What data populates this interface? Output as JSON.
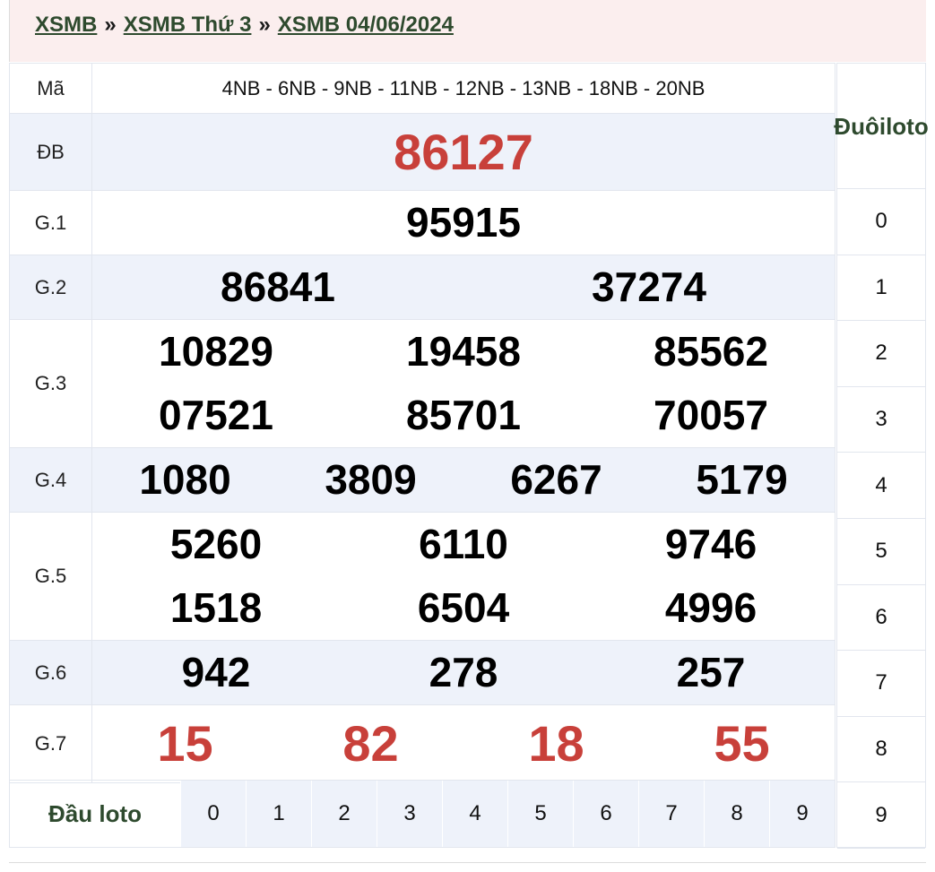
{
  "breadcrumb": {
    "items": [
      "XSMB",
      "XSMB Thứ 3",
      "XSMB 04/06/2024"
    ],
    "separator": "»"
  },
  "results": {
    "code_label": "Mã",
    "codes": "4NB - 6NB - 9NB - 11NB - 12NB - 13NB - 18NB - 20NB",
    "prizes": {
      "db": {
        "label": "ĐB",
        "numbers": [
          "86127"
        ]
      },
      "g1": {
        "label": "G.1",
        "numbers": [
          "95915"
        ]
      },
      "g2": {
        "label": "G.2",
        "numbers": [
          "86841",
          "37274"
        ]
      },
      "g3": {
        "label": "G.3",
        "numbers": [
          "10829",
          "19458",
          "85562",
          "07521",
          "85701",
          "70057"
        ]
      },
      "g4": {
        "label": "G.4",
        "numbers": [
          "1080",
          "3809",
          "6267",
          "5179"
        ]
      },
      "g5": {
        "label": "G.5",
        "numbers": [
          "5260",
          "6110",
          "9746",
          "1518",
          "6504",
          "4996"
        ]
      },
      "g6": {
        "label": "G.6",
        "numbers": [
          "942",
          "278",
          "257"
        ]
      },
      "g7": {
        "label": "G.7",
        "numbers": [
          "15",
          "82",
          "18",
          "55"
        ]
      }
    }
  },
  "dau_loto": {
    "title": "Đầu loto",
    "digits": [
      "0",
      "1",
      "2",
      "3",
      "4",
      "5",
      "6",
      "7",
      "8",
      "9"
    ]
  },
  "duoi_loto": {
    "title_line1": "Đuôi",
    "title_line2": "loto",
    "digits": [
      "0",
      "1",
      "2",
      "3",
      "4",
      "5",
      "6",
      "7",
      "8",
      "9"
    ]
  },
  "colors": {
    "accent_red": "#c8403a",
    "link_green": "#2e4a2e",
    "header_bg": "#fbeeee",
    "row_alt_bg": "#eef2fa"
  }
}
